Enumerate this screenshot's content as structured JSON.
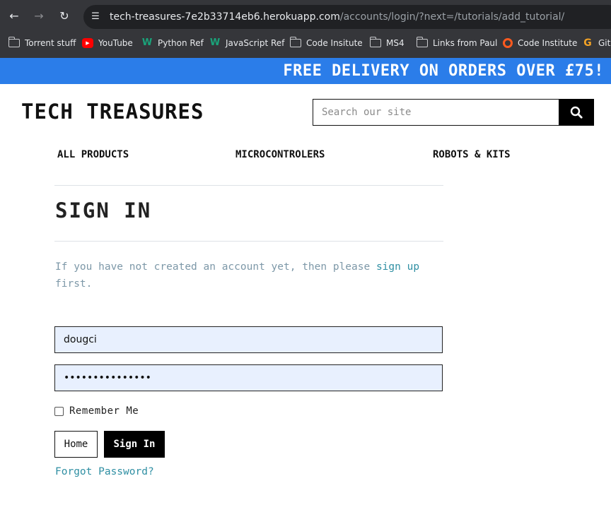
{
  "browser": {
    "url_host": "tech-treasures-7e2b33714eb6.herokuapp.com",
    "url_path": "/accounts/login/?next=/tutorials/add_tutorial/",
    "bookmarks": [
      {
        "label": "Torrent stuff",
        "icon": "folder-icon"
      },
      {
        "label": "YouTube",
        "icon": "youtube-icon"
      },
      {
        "label": "Python Ref",
        "icon": "w3schools-icon"
      },
      {
        "label": "JavaScript Ref",
        "icon": "w3schools-icon"
      },
      {
        "label": "Code Insitute",
        "icon": "folder-icon"
      },
      {
        "label": "MS4",
        "icon": "folder-icon"
      },
      {
        "label": "Links from Paul",
        "icon": "folder-icon"
      },
      {
        "label": "Code Institute",
        "icon": "code-institute-icon"
      },
      {
        "label": "Gitp",
        "icon": "gitpod-icon"
      }
    ]
  },
  "banner": {
    "text": "FREE DELIVERY ON ORDERS OVER £75!",
    "color": "#2b7de9"
  },
  "header": {
    "logo": "TECH TREASURES",
    "search_placeholder": "Search our site"
  },
  "nav": {
    "items": [
      {
        "label": "ALL PRODUCTS"
      },
      {
        "label": "MICROCONTROLERS"
      },
      {
        "label": "ROBOTS & KITS"
      }
    ]
  },
  "signin": {
    "title": "SIGN IN",
    "intro_before": "If you have not created an account yet, then please ",
    "intro_link": "sign up",
    "intro_after": " first.",
    "username_value": "dougci",
    "password_value": "•••••••••••••••",
    "remember_label": "Remember Me",
    "home_button": "Home",
    "signin_button": "Sign In",
    "forgot_link": "Forgot Password?"
  },
  "colors": {
    "link": "#2f8fa3",
    "field_bg": "#e8f0fe",
    "muted_text": "#7d98a8"
  }
}
